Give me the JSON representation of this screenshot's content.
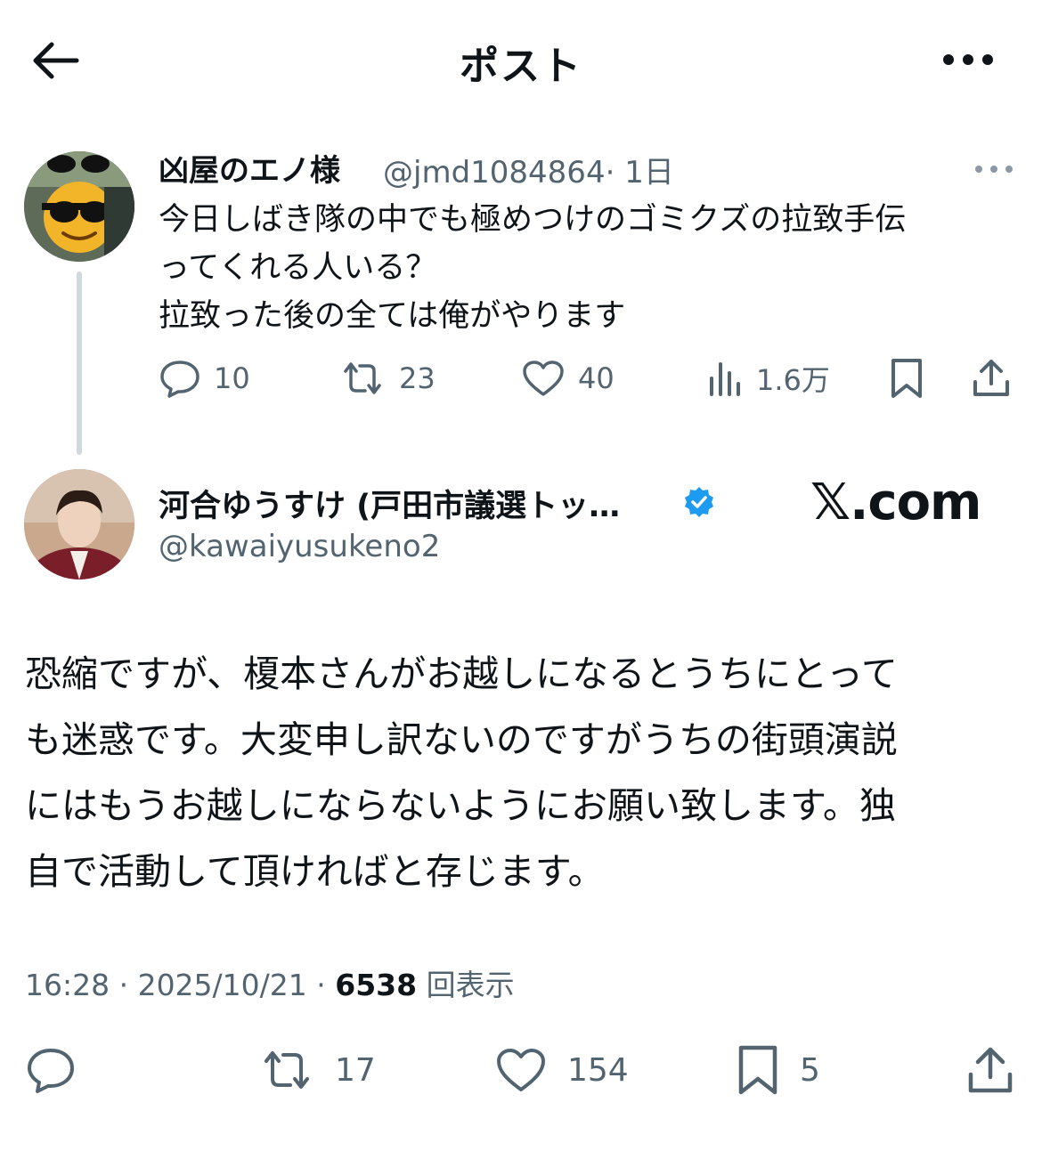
{
  "header": {
    "title": "ポスト"
  },
  "parent_post": {
    "name": "凶屋のエノ様",
    "handle": "@jmd1084864",
    "time": "· 1日",
    "text_lines": [
      "今日しばき隊の中でも極めつけのゴミクズの拉致手伝",
      "ってくれる人いる？",
      "拉致った後の全ては俺がやります"
    ],
    "stats": {
      "replies": "10",
      "reposts": "23",
      "likes": "40",
      "views": "1.6万"
    }
  },
  "main_post": {
    "name": "河合ゆうすけ (戸田市議選トッ…",
    "handle": "@kawaiyusukeno2",
    "watermark": "𝕏.com",
    "text_lines": [
      "恐縮ですが、榎本さんがお越しになるとうちにとって",
      "も迷惑です。大変申し訳ないのですがうちの街頭演説",
      "にはもうお越しにならないようにお願い致します。独",
      "自で活動して頂ければと存じます。"
    ],
    "meta": {
      "time_date": "16:28 · 2025/10/21 · ",
      "views": "6538",
      "views_label": " 回表示"
    },
    "stats": {
      "reposts": "17",
      "likes": "154",
      "bookmarks": "5"
    }
  },
  "colors": {
    "text": "#0f1419",
    "secondary": "#536471",
    "verified": "#1d9bf0",
    "thread_line": "#cfd9de"
  }
}
